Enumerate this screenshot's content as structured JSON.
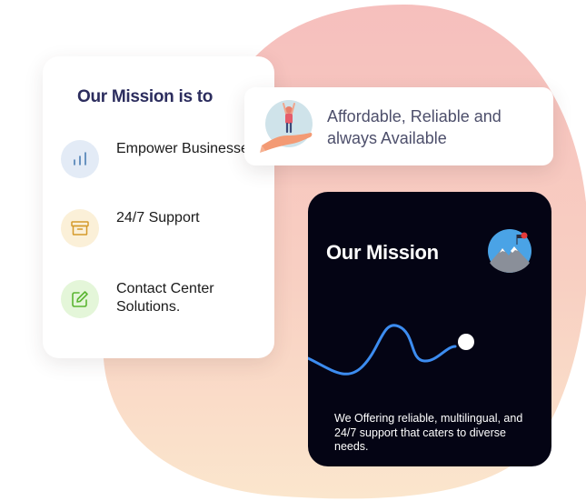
{
  "left_card": {
    "title": "Our Mission is to",
    "items": [
      {
        "label": "Empower Businesses",
        "icon": "bar-chart-icon"
      },
      {
        "label": "24/7 Support",
        "icon": "archive-box-icon"
      },
      {
        "label": "Contact Center Solutions.",
        "icon": "edit-pencil-icon"
      }
    ]
  },
  "top_card": {
    "text": "Affordable, Reliable and always Available"
  },
  "dark_card": {
    "title": "Our Mission",
    "description": "We Offering reliable, multilingual, and 24/7 support that caters to diverse needs."
  },
  "colors": {
    "navy_text": "#2c2d5e",
    "dark_card_bg": "#040414",
    "wave_blue": "#3c8cf0",
    "blob_top": "#f6c0bd",
    "blob_bottom": "#fbe3c8"
  }
}
